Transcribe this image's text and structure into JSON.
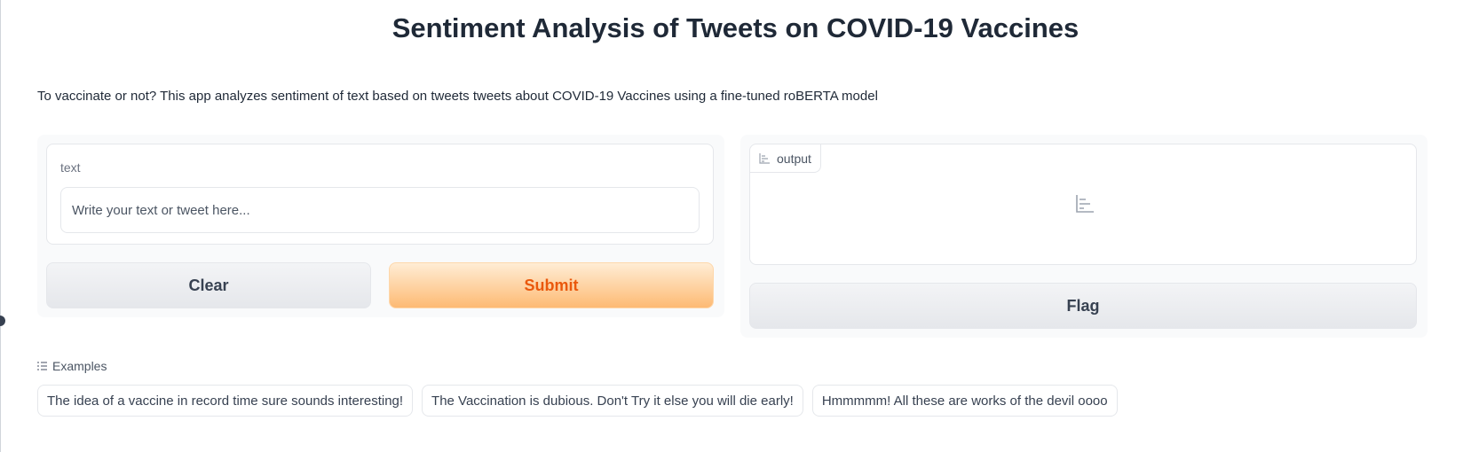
{
  "title": "Sentiment Analysis of Tweets on COVID-19 Vaccines",
  "description": "To vaccinate or not? This app analyzes sentiment of text based on tweets tweets about COVID-19 Vaccines using a fine-tuned roBERTA model",
  "input": {
    "label": "text",
    "placeholder": "Write your text or tweet here...",
    "value": ""
  },
  "buttons": {
    "clear": "Clear",
    "submit": "Submit",
    "flag": "Flag"
  },
  "output": {
    "label": "output",
    "icon": "bar-chart-icon"
  },
  "examples": {
    "heading": "Examples",
    "heading_icon": "list-icon",
    "items": [
      "The idea of a vaccine in record time sure sounds interesting!",
      "The Vaccination is dubious. Don't Try it else you will die early!",
      "Hmmmmm! All these are works of the devil oooo"
    ]
  },
  "colors": {
    "accent": "#ea580c",
    "submit_gradient_end": "#fdba74",
    "panel_bg": "#f9fafb"
  }
}
